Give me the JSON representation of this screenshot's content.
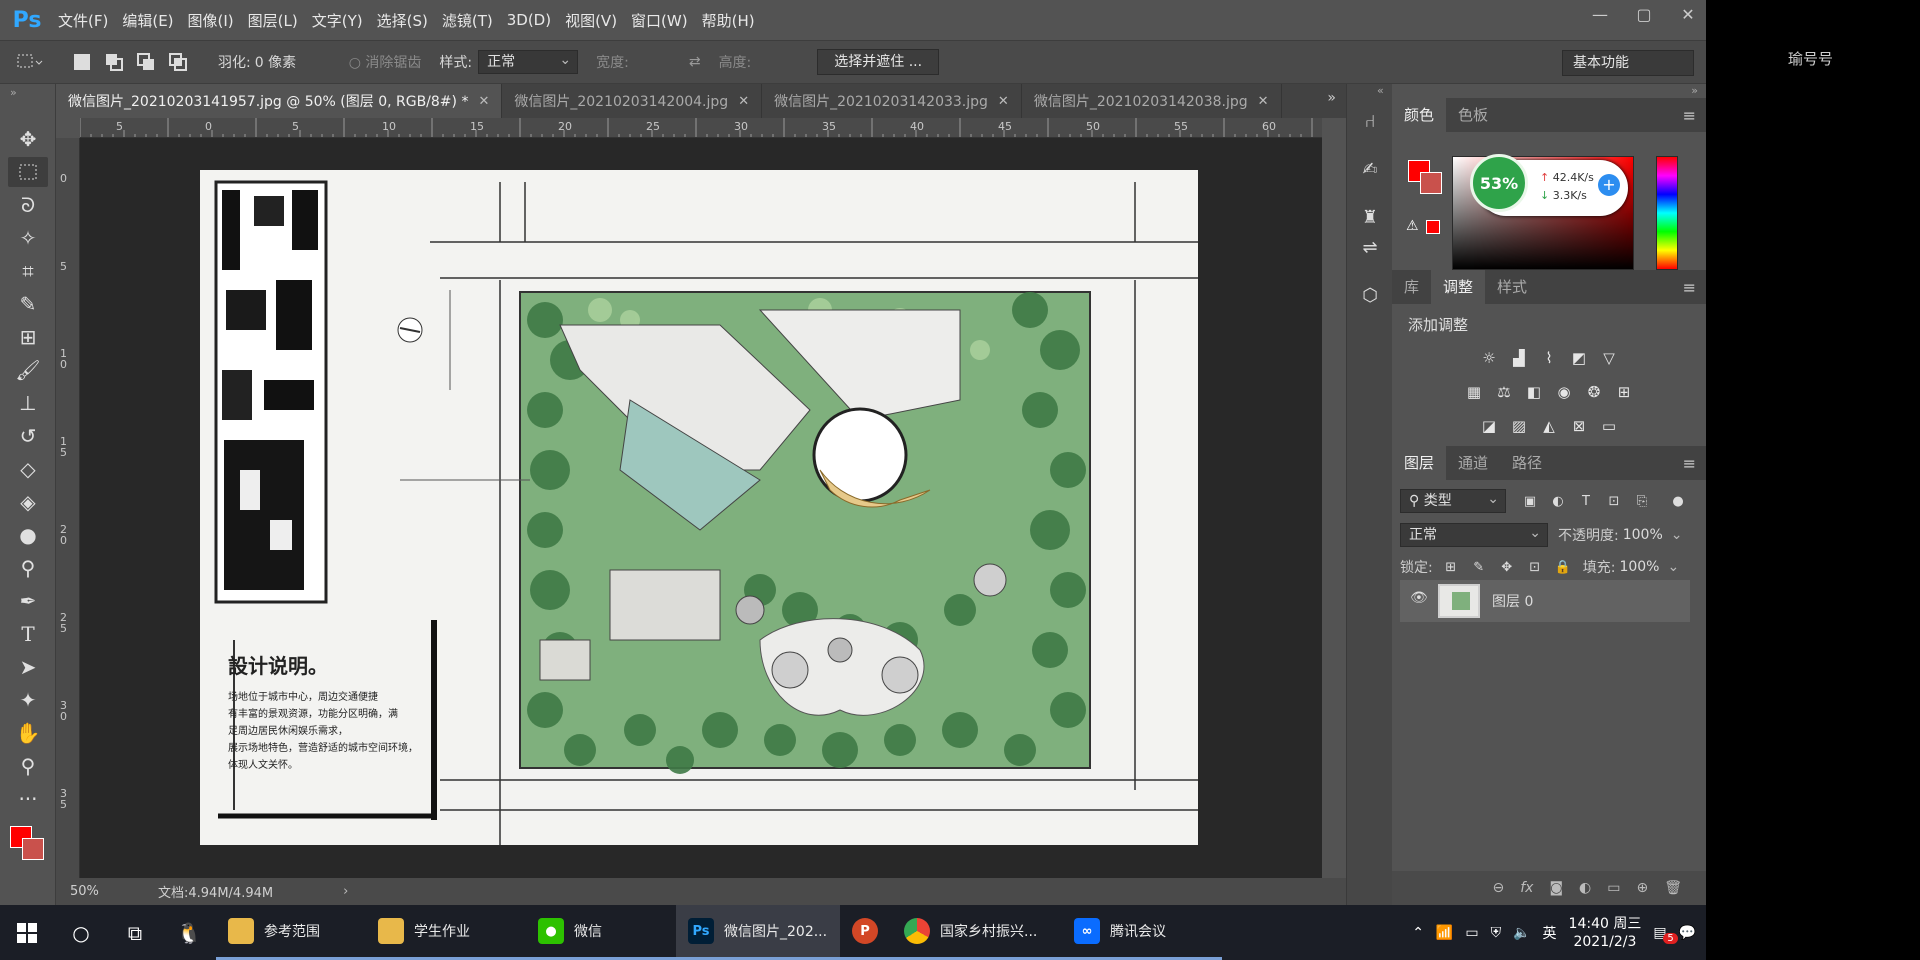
{
  "menubar": {
    "logo": "Ps",
    "items": [
      "文件(F)",
      "编辑(E)",
      "图像(I)",
      "图层(L)",
      "文字(Y)",
      "选择(S)",
      "滤镜(T)",
      "3D(D)",
      "视图(V)",
      "窗口(W)",
      "帮助(H)"
    ]
  },
  "watermark": "瑜号号",
  "options": {
    "feather_label": "羽化:",
    "feather_value": "0 像素",
    "antialias_label": "消除锯齿",
    "style_label": "样式:",
    "style_value": "正常",
    "width_label": "宽度:",
    "height_label": "高度:",
    "select_mask_button": "选择并遮住 ...",
    "workspace": "基本功能"
  },
  "tabs": [
    {
      "label": "微信图片_20210203141957.jpg @ 50% (图层 0, RGB/8#) *",
      "active": true
    },
    {
      "label": "微信图片_20210203142004.jpg",
      "active": false
    },
    {
      "label": "微信图片_20210203142033.jpg",
      "active": false
    },
    {
      "label": "微信图片_20210203142038.jpg",
      "active": false
    }
  ],
  "tab_overflow": "»",
  "ruler_top": [
    "5",
    "0",
    "5",
    "10",
    "15",
    "20",
    "25",
    "30",
    "35",
    "40",
    "45",
    "50",
    "55",
    "60"
  ],
  "ruler_left": [
    "0",
    "5",
    "1 0",
    "1 5",
    "2 0",
    "2 5",
    "3 0",
    "3 5"
  ],
  "drawing": {
    "title": "設计说明。",
    "lines": [
      "场地位于城市中心，周边交通便捷",
      "有丰富的景观资源，功能分区明确，满",
      "足周边居民休闲娱乐需求，",
      "展示场地特色，营造舒适的城市空间环境，",
      "体现人文关怀。"
    ]
  },
  "status": {
    "zoom": "50%",
    "doc": "文档:4.94M/4.94M"
  },
  "color_panel": {
    "tabs": [
      "颜色",
      "色板"
    ],
    "fg": "#ff0000",
    "bg": "#c9514c"
  },
  "net_widget": {
    "percent": "53%",
    "up": "42.4K/s",
    "down": "3.3K/s"
  },
  "adjust_panel": {
    "tabs": [
      "库",
      "调整",
      "样式"
    ],
    "title": "添加调整"
  },
  "layers_panel": {
    "tabs": [
      "图层",
      "通道",
      "路径"
    ],
    "filter": "类型",
    "blend": "正常",
    "opacity_label": "不透明度:",
    "opacity": "100%",
    "lock_label": "锁定:",
    "fill_label": "填充:",
    "fill": "100%",
    "layer_name": "图层 0"
  },
  "taskbar": {
    "apps": [
      {
        "label": "参考范围",
        "icon": "folder-icon",
        "color": "#e8b84a"
      },
      {
        "label": "学生作业",
        "icon": "folder-icon",
        "color": "#e8b84a"
      },
      {
        "label": "微信",
        "icon": "wechat-icon",
        "color": "#2dc100"
      },
      {
        "label": "微信图片_202...",
        "icon": "photoshop-icon",
        "color": "#001e36"
      },
      {
        "label": "",
        "icon": "powerpoint-icon",
        "color": "#d24726"
      },
      {
        "label": "国家乡村振兴...",
        "icon": "chrome-icon",
        "color": "#4285f4"
      },
      {
        "label": "腾讯会议",
        "icon": "tencent-meeting-icon",
        "color": "#0a6cff"
      }
    ],
    "ime": "英",
    "time": "14:40 周三",
    "date": "2021/2/3",
    "notify_count": "5"
  }
}
